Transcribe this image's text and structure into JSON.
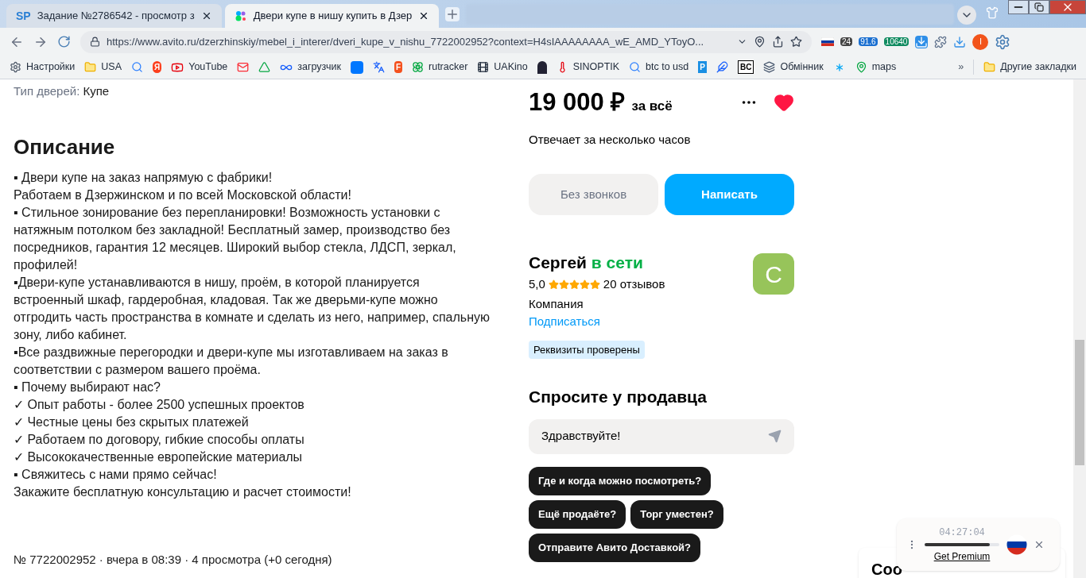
{
  "tabs": [
    {
      "glyph": "SP",
      "title": "Задание №2786542 - просмотр з",
      "selected": false
    },
    {
      "title": "Двери купе в нишу купить в Дзер",
      "selected": true
    }
  ],
  "address_bar": {
    "url": "https://www.avito.ru/dzerzhinskiy/mebel_i_interer/dveri_kupe_v_nishu_7722002952?context=H4sIAAAAAAAA_wE_AMD_YToyO...",
    "extension_badges": [
      "24",
      "91.6",
      "10640"
    ],
    "profile_initial": "I"
  },
  "bookmarks": [
    {
      "kind": "labeled",
      "label": "Настройки"
    },
    {
      "kind": "labeled",
      "label": "USA"
    },
    {
      "kind": "icon"
    },
    {
      "kind": "glyph",
      "glyph": "Я"
    },
    {
      "kind": "labeled",
      "label": "YouTube"
    },
    {
      "kind": "icon"
    },
    {
      "kind": "icon"
    },
    {
      "kind": "labeled",
      "label": "загрузчик"
    },
    {
      "kind": "icon"
    },
    {
      "kind": "icon"
    },
    {
      "kind": "glyph",
      "glyph": "F"
    },
    {
      "kind": "labeled",
      "label": "rutracker"
    },
    {
      "kind": "labeled",
      "label": "UAKino"
    },
    {
      "kind": "icon"
    },
    {
      "kind": "labeled",
      "label": "SINOPTIK"
    },
    {
      "kind": "labeled",
      "label": "btc to usd"
    },
    {
      "kind": "glyph",
      "glyph": "P"
    },
    {
      "kind": "icon"
    },
    {
      "kind": "glyph",
      "glyph": "BC"
    },
    {
      "kind": "labeled",
      "label": "Обмінник"
    },
    {
      "kind": "icon"
    },
    {
      "kind": "labeled",
      "label": "maps"
    }
  ],
  "other_bookmarks": {
    "more": "»",
    "label": "Другие закладки"
  },
  "listing": {
    "param_label": "Тип дверей:",
    "param_value": "Купе",
    "description_title": "Описание",
    "description": [
      "▪ Двери купе на заказ напрямую с фабрики!",
      "Работаем в Дзержинском и по всей Московской области!",
      "▪ Стильное зонирование без перепланировки! Возможность установки с натяжным потолком без закладной! Бесплатный замер, производство без посредников, гарантия 12 месяцев. Широкий выбор стекла, ЛДСП, зеркал, профилей!",
      "▪Двери-купе устанавливаются в нишу, проём, в которой планируется встроенный шкаф, гардеробная, кладовая. Так же дверьми-купе можно отгродить часть пространства в комнате и сделать из него, например, спальную зону, либо кабинет.",
      "▪Все раздвижные перегородки и двери-купе мы изготавливаем на заказ в соответствии с размером вашего проёма.",
      "▪ Почему выбирают нас?",
      "✓ Опыт работы - более 2500 успешных проектов",
      "✓ Честные цены без скрытых платежей",
      "✓ Работаем по договору, гибкие способы оплаты",
      "✓ Высококачественные европейские материалы",
      "▪ Свяжитесь с нами прямо сейчас!",
      "Закажите бесплатную консультацию и расчет стоимости!"
    ],
    "footer": "№ 7722002952 · вчера в 08:39 · 4 просмотра (+0 сегодня)"
  },
  "sidebar": {
    "price": "19 000 ₽",
    "price_note": "за всё",
    "favorite": true,
    "response_time": "Отвечает за несколько часов",
    "buttons": [
      "Без звонков",
      "Написать"
    ],
    "seller": {
      "name": "Сергей",
      "status": "в сети",
      "rating": "5,0",
      "stars": 5,
      "reviews": "20 отзывов",
      "type": "Компания",
      "subscribe": "Подписаться",
      "badge": "Реквизиты проверены",
      "avatar_letter": "С"
    },
    "ask_title": "Спросите у продавца",
    "message": "Здравствуйте!",
    "quick_questions": [
      [
        "Где и когда можно посмотреть?"
      ],
      [
        "Ещё продаёте?",
        "Торг уместен?"
      ],
      [
        "Отправите Авито Доставкой?"
      ]
    ]
  },
  "cookie_banner": {
    "text": "Coo"
  },
  "timer_widget": {
    "time": "04:27:04",
    "level": 0.87,
    "link": "Get Premium"
  }
}
